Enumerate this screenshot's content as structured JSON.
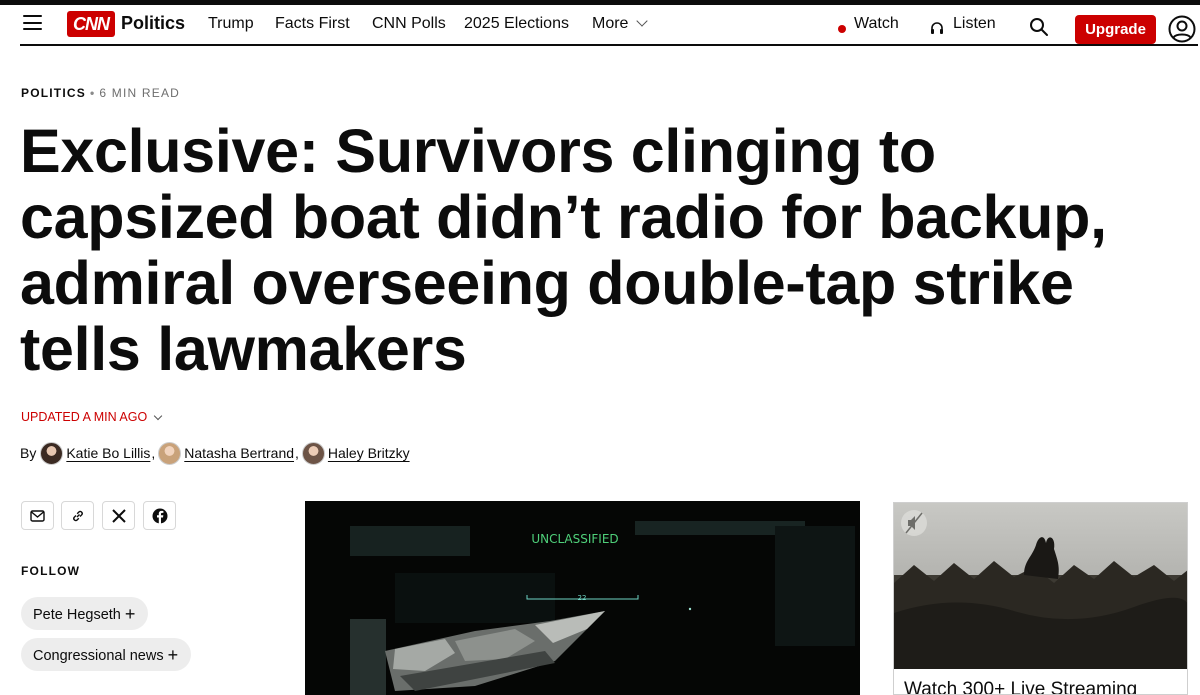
{
  "nav": {
    "section": "Politics",
    "logo_text": "CNN",
    "links": [
      "Trump",
      "Facts First",
      "CNN Polls",
      "2025 Elections"
    ],
    "more_label": "More",
    "watch_label": "Watch",
    "listen_label": "Listen",
    "upgrade_label": "Upgrade"
  },
  "article": {
    "kicker": "POLITICS",
    "kicker_sep": "•",
    "read_time": "6 MIN READ",
    "headline": "Exclusive: Survivors clinging to capsized boat didn’t radio for backup, admiral overseeing double-tap strike tells lawmakers",
    "updated": "UPDATED A MIN AGO",
    "by_label": "By",
    "authors": [
      "Katie Bo Lillis",
      "Natasha Bertrand",
      "Haley Britzky"
    ]
  },
  "share": {
    "icons": [
      "email-icon",
      "link-icon",
      "x-icon",
      "facebook-icon"
    ]
  },
  "follow": {
    "label": "FOLLOW",
    "topics": [
      "Pete Hegseth",
      "Congressional news"
    ],
    "plus": "+"
  },
  "video": {
    "overlay_text": "UNCLASSIFIED",
    "reticle_number": "22"
  },
  "ad": {
    "caption": "Watch 300+ Live Streaming"
  },
  "colors": {
    "brand_red": "#cc0000",
    "overlay_green": "#4fd07a"
  }
}
